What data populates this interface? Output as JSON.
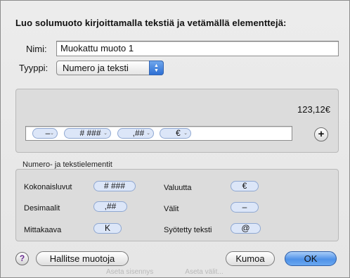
{
  "dialog": {
    "title": "Luo solumuoto kirjoittamalla tekstiä ja vetämällä elementtejä:",
    "name_label": "Nimi:",
    "name_value": "Muokattu muoto 1",
    "type_label": "Tyyppi:",
    "type_value": "Numero ja teksti",
    "preview_value": "123,12€",
    "format_tokens": [
      "–",
      "# ###",
      ",##",
      "€"
    ],
    "elements_heading": "Numero- ja tekstielementit",
    "elements": [
      {
        "label": "Kokonaisluvut",
        "token": "# ###"
      },
      {
        "label": "Desimaalit",
        "token": ",##"
      },
      {
        "label": "Mittakaava",
        "token": "K"
      },
      {
        "label": "Valuutta",
        "token": "€"
      },
      {
        "label": "Välit",
        "token": "–"
      },
      {
        "label": "Syötetty teksti",
        "token": "@"
      }
    ],
    "help_label": "?",
    "manage_button": "Hallitse muotoja",
    "cancel_button": "Kumoa",
    "ok_button": "OK",
    "plus_label": "+"
  },
  "background_hint": {
    "left": "Aseta sisennys",
    "right": "Aseta välit..."
  },
  "colors": {
    "accent": "#4f92e8",
    "token_bg": "#dce6f8",
    "token_border": "#8fa8d2"
  }
}
